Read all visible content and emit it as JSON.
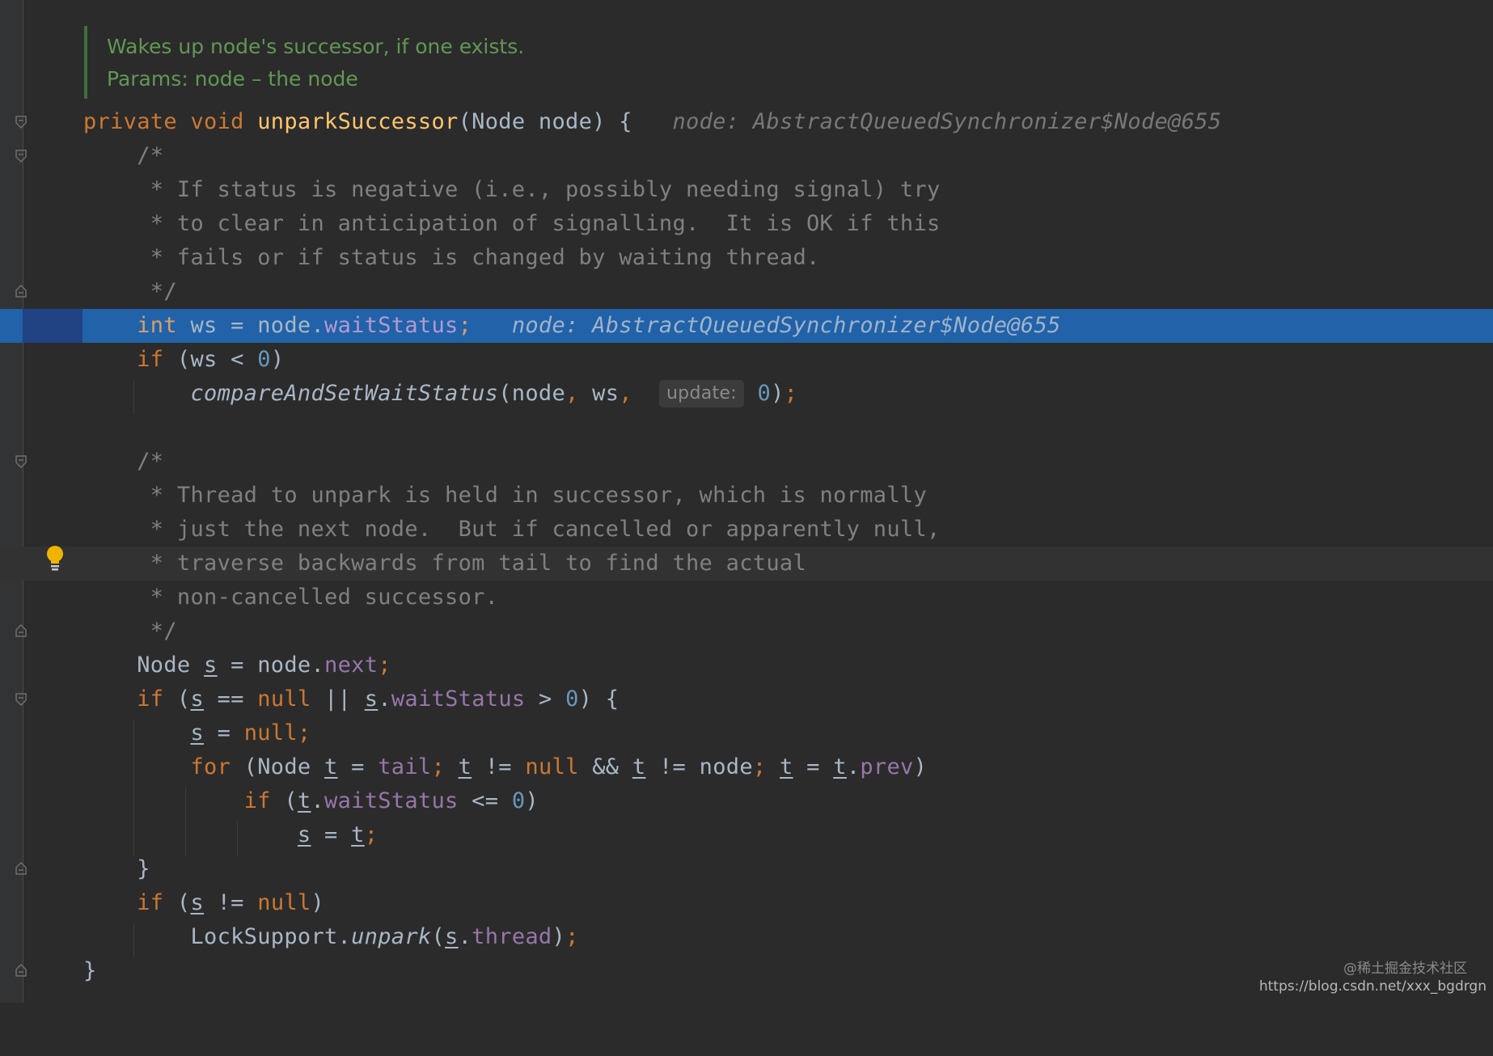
{
  "doc": {
    "summary": "Wakes up node's successor, if one exists.",
    "params": "Params: node – the node"
  },
  "code": {
    "sig_private": "private",
    "sig_void": "void",
    "sig_name": "unparkSuccessor",
    "sig_params": "(Node node) {",
    "sig_hint": "node: AbstractQueuedSynchronizer$Node@655",
    "c1_open": "/*",
    "c1_l1": " * If status is negative (i.e., possibly needing signal) try",
    "c1_l2": " * to clear in anticipation of signalling.  It is OK if this",
    "c1_l3": " * fails or if status is changed by waiting thread.",
    "c1_close": " */",
    "exec_int": "int",
    "exec_mid": " ws = node.",
    "exec_field": "waitStatus",
    "exec_semi": ";",
    "exec_hint": "node: AbstractQueuedSynchronizer$Node@655",
    "if1_kw": "if",
    "if1_a": " (ws < ",
    "if1_num": "0",
    "if1_b": ")",
    "cas_fn": "compareAndSetWaitStatus",
    "cas_a": "(node",
    "cas_comma1": ",",
    "cas_ws": " ws",
    "cas_comma2": ",",
    "cas_inlay": "update:",
    "cas_num": "0",
    "cas_end": ")",
    "cas_semi": ";",
    "c2_open": "/*",
    "c2_l1": " * Thread to unpark is held in successor, which is normally",
    "c2_l2": " * just the next node.  But if cancelled or apparently null,",
    "c2_l3": " * traverse backwards from tail to find the actual",
    "c2_l4": " * non-cancelled successor.",
    "c2_close": " */",
    "s_decl_type": "Node ",
    "s_var": "s",
    "s_decl_mid": " = node.",
    "s_decl_field": "next",
    "semi": ";",
    "if2_kw": "if",
    "if2_a": " (",
    "if2_null": "null",
    "if2_eq": " == ",
    "if2_or": " || ",
    "if2_field": "waitStatus",
    "if2_gt": " > ",
    "if2_num": "0",
    "if2_end": ") {",
    "dot": ".",
    "s_assign": " = ",
    "null": "null",
    "for_kw": "for",
    "for_a": " (Node ",
    "t_var": "t",
    "for_eq": " = ",
    "for_tail": "tail",
    "for_neq": " != ",
    "for_and": " && ",
    "for_node": " != node",
    "for_prev": "prev",
    "paren_close": ")",
    "if3_kw": "if",
    "if3_a": " (",
    "if3_field": "waitStatus",
    "if3_le": " <= ",
    "if3_num": "0",
    "brace_close": "}",
    "if4_kw": "if",
    "if4_neq": " != ",
    "ls_class": "LockSupport.",
    "ls_fn": "unpark",
    "ls_open": "(",
    "ls_field": "thread",
    "method_close": "}"
  },
  "watermark": {
    "community": "@稀土掘金技术社区",
    "url": "https://blog.csdn.net/xxx_bgdrgn"
  },
  "colors": {
    "background": "#2b2b2b",
    "execution_line": "#2162a8",
    "keyword": "#cc7832",
    "method": "#ffc66d",
    "field": "#9876aa",
    "number": "#6897bb",
    "comment": "#808080",
    "javadoc": "#629755"
  },
  "icons": [
    "fold-icon",
    "lightbulb-icon"
  ]
}
